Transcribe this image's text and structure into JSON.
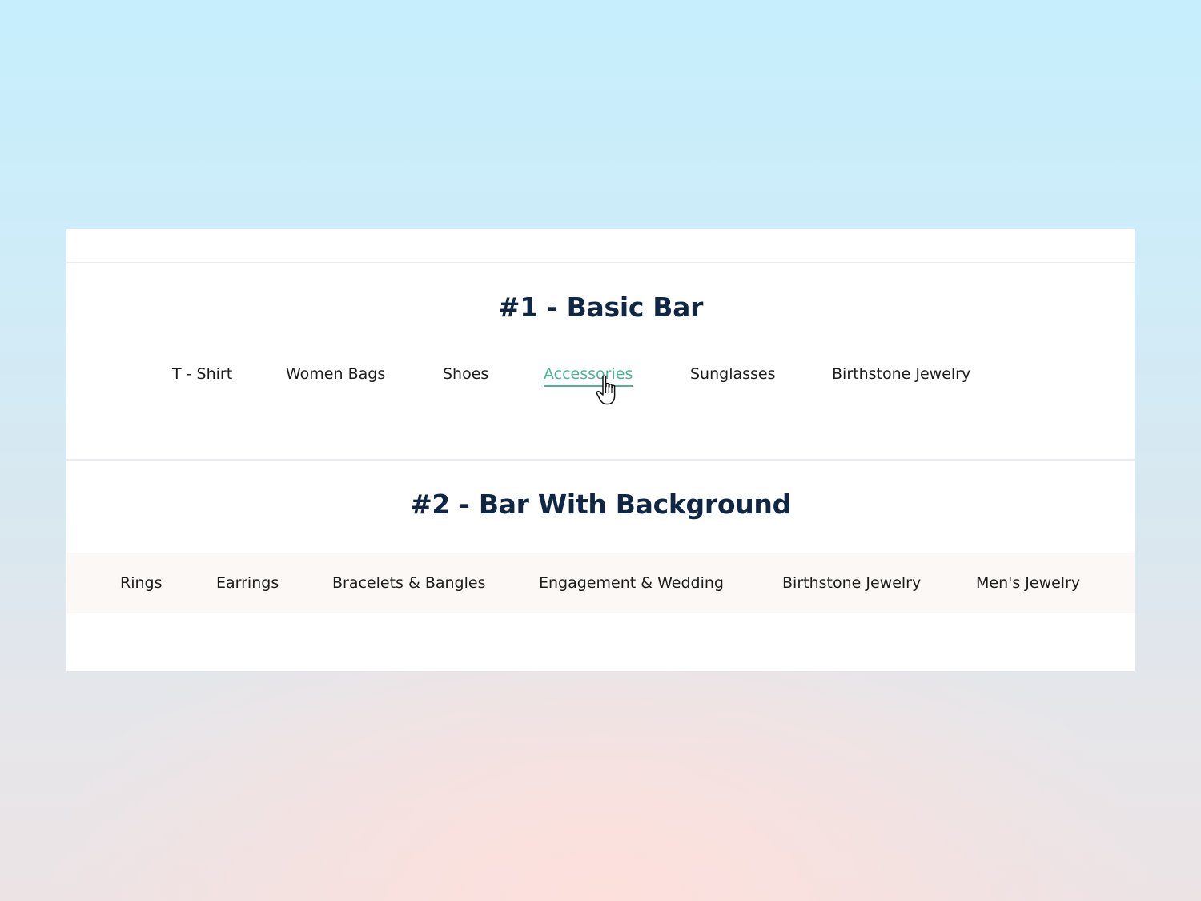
{
  "section1": {
    "title": "#1 - Basic Bar",
    "items": [
      "T - Shirt",
      "Women Bags",
      "Shoes",
      "Accessories",
      "Sunglasses",
      "Birthstone Jewelry"
    ],
    "active_item": "Accessories"
  },
  "section2": {
    "title": "#2 - Bar With Background",
    "items": [
      "Rings",
      "Earrings",
      "Bracelets & Bangles",
      "Engagement & Wedding",
      "Birthstone Jewelry",
      "Men's Jewelry"
    ]
  },
  "colors": {
    "heading": "#0f2645",
    "active": "#4bb48f",
    "bar_background": "#fcf8f5"
  },
  "icons": {
    "cursor": "hand-pointer-icon"
  }
}
